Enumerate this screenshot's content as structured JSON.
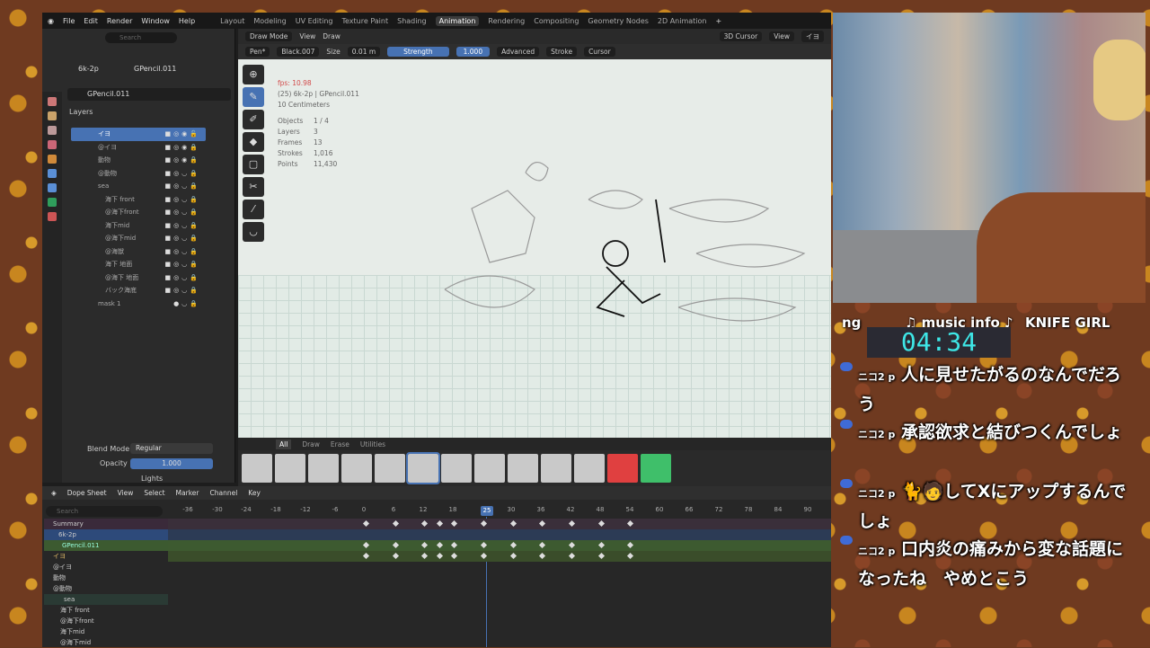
{
  "menu": {
    "items": [
      "File",
      "Edit",
      "Render",
      "Window",
      "Help"
    ],
    "workspaces": [
      "Layout",
      "Modeling",
      "UV Editing",
      "Texture Paint",
      "Shading",
      "Animation",
      "Rendering",
      "Compositing",
      "Geometry Nodes",
      "2D Animation"
    ],
    "active_workspace": "Animation"
  },
  "outliner": {
    "search_placeholder": "Search",
    "scene": "6k-2p",
    "object": "GPencil.011",
    "data_name": "GPencil.011"
  },
  "layers_panel": {
    "title": "Layers",
    "items": [
      "イヨ",
      "@イヨ",
      "動物",
      "@動物",
      "sea",
      "海下 front",
      "@海下front",
      "海下mid",
      "@海下mid",
      "@海獣",
      "海下 地面",
      "@海下 地面",
      "バック海底",
      "mask 1"
    ],
    "selected": "イヨ"
  },
  "blend": {
    "label": "Blend Mode",
    "value": "Regular",
    "opacity_label": "Opacity",
    "opacity_value": "1.000",
    "lights_label": "Lights"
  },
  "viewport": {
    "mode": "Draw Mode",
    "menus": [
      "View",
      "Draw"
    ],
    "cursor": "3D Cursor",
    "view": "View",
    "layer": "イヨ",
    "brush": "Pen*",
    "material": "Black.007",
    "size_label": "Size",
    "size_value": "0.01 m",
    "strength_label": "Strength",
    "strength_value": "1.000",
    "advanced": "Advanced",
    "stroke": "Stroke",
    "cursor_menu": "Cursor"
  },
  "stats": {
    "fps": "fps: 10.98",
    "object_line": "(25) 6k-2p | GPencil.011",
    "scale": "10 Centimeters",
    "rows": [
      [
        "Objects",
        "1 / 4"
      ],
      [
        "Layers",
        "3"
      ],
      [
        "Frames",
        "13"
      ],
      [
        "Strokes",
        "1,016"
      ],
      [
        "Points",
        "11,430"
      ]
    ]
  },
  "brush_tabs": [
    "All",
    "Draw",
    "Erase",
    "Utilities"
  ],
  "dopesheet": {
    "title": "Dope Sheet",
    "menus": [
      "View",
      "Select",
      "Marker",
      "Channel",
      "Key"
    ],
    "search_placeholder": "Search",
    "ruler": [
      "-36",
      "-30",
      "-24",
      "-18",
      "-12",
      "-6",
      "0",
      "6",
      "12",
      "18",
      "25",
      "30",
      "36",
      "42",
      "48",
      "54",
      "60",
      "66",
      "72",
      "78",
      "84",
      "90"
    ],
    "current_frame": "25",
    "channels": [
      "Summary",
      "6k-2p",
      "GPencil.011",
      "イヨ",
      "@イヨ",
      "動物",
      "@動物",
      "sea",
      "海下 front",
      "@海下front",
      "海下mid",
      "@海下mid"
    ]
  },
  "stream": {
    "ng": "ng",
    "music_info": "♫ music info ♪",
    "song": "KNIFE GIRL",
    "timer": "04:34",
    "user": "ニコ2 p",
    "messages": [
      "人に見せたがるのなんでだろう",
      "承認欲求と結びつくんでしょ",
      "🐈🧑してXにアップするんでしょ",
      "口内炎の痛みから変な話題になったね　やめとこう"
    ]
  },
  "colors": {
    "accent": "#4772b3",
    "timer": "#3ee6e6",
    "layer_select": "#4772b3"
  }
}
